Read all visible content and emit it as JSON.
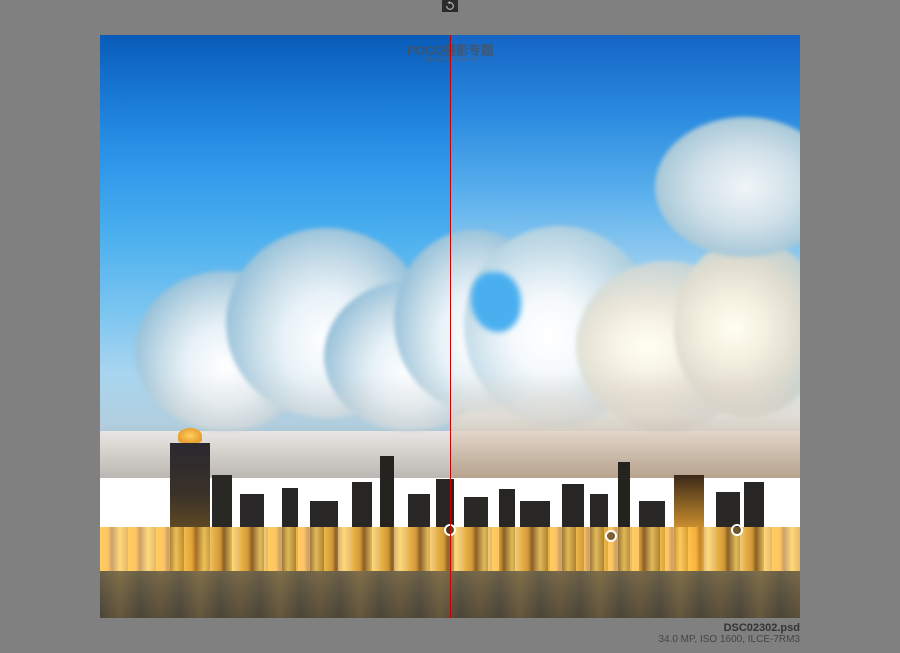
{
  "watermark": {
    "logo": "POCO摄影专题",
    "url": "http://photo.poco.cn/"
  },
  "file": {
    "name": "DSC02302.psd",
    "meta": "34.0 MP, ISO 1600, ILCE-7RM3"
  }
}
